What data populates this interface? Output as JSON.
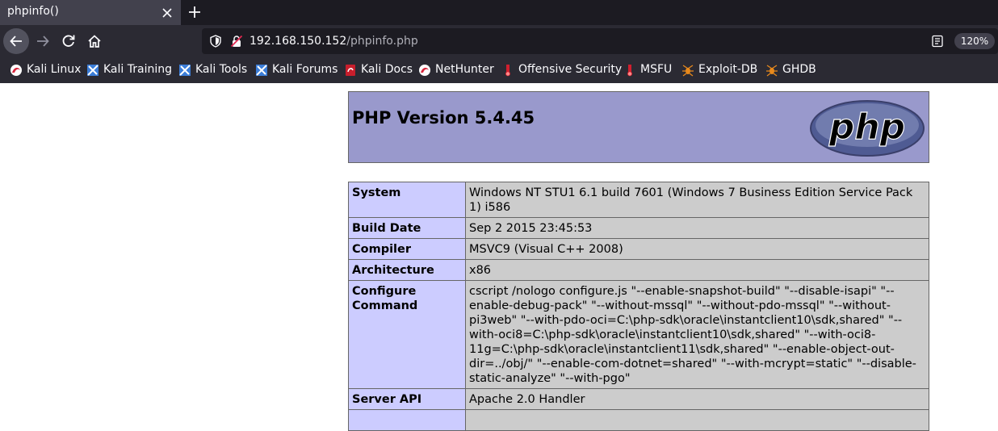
{
  "browser": {
    "tab": {
      "title": "phpinfo()"
    },
    "url": {
      "host": "192.168.150.152",
      "path": "/phpinfo.php"
    },
    "zoom": "120%",
    "bookmarks": [
      {
        "label": "Kali Linux",
        "icon": "kali-dragon-icon"
      },
      {
        "label": "Kali Training",
        "icon": "kali-flag-icon"
      },
      {
        "label": "Kali Tools",
        "icon": "kali-flag-icon"
      },
      {
        "label": "Kali Forums",
        "icon": "kali-flag-icon"
      },
      {
        "label": "Kali Docs",
        "icon": "kali-docs-icon"
      },
      {
        "label": "NetHunter",
        "icon": "kali-dragon-icon"
      },
      {
        "label": "Offensive Security",
        "icon": "offsec-icon"
      },
      {
        "label": "MSFU",
        "icon": "offsec-icon"
      },
      {
        "label": "Exploit-DB",
        "icon": "exploit-db-icon"
      },
      {
        "label": "GHDB",
        "icon": "exploit-db-icon"
      }
    ]
  },
  "page": {
    "title": "PHP Version 5.4.45",
    "logo_text": "php",
    "rows": [
      {
        "key": "System",
        "value": "Windows NT STU1 6.1 build 7601 (Windows 7 Business Edition Service Pack 1) i586"
      },
      {
        "key": "Build Date",
        "value": "Sep 2 2015 23:45:53"
      },
      {
        "key": "Compiler",
        "value": "MSVC9 (Visual C++ 2008)"
      },
      {
        "key": "Architecture",
        "value": "x86"
      },
      {
        "key": "Configure Command",
        "value": "cscript /nologo configure.js \"--enable-snapshot-build\" \"--disable-isapi\" \"--enable-debug-pack\" \"--without-mssql\" \"--without-pdo-mssql\" \"--without-pi3web\" \"--with-pdo-oci=C:\\php-sdk\\oracle\\instantclient10\\sdk,shared\" \"--with-oci8=C:\\php-sdk\\oracle\\instantclient10\\sdk,shared\" \"--with-oci8-11g=C:\\php-sdk\\oracle\\instantclient11\\sdk,shared\" \"--enable-object-out-dir=../obj/\" \"--enable-com-dotnet=shared\" \"--with-mcrypt=static\" \"--disable-static-analyze\" \"--with-pgo\""
      },
      {
        "key": "Server API",
        "value": "Apache 2.0 Handler"
      },
      {
        "key": "",
        "value": ""
      }
    ]
  },
  "colors": {
    "chrome_dark": "#1c1b22",
    "chrome_mid": "#2b2a33",
    "tab_active": "#42414d",
    "header_bg": "#9999cc",
    "key_bg": "#ccccff",
    "value_bg": "#cccccc"
  }
}
